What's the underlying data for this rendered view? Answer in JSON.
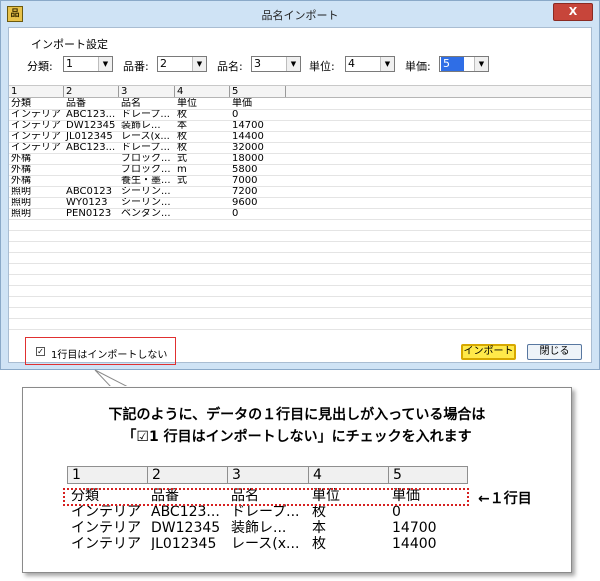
{
  "window": {
    "title": "品名インポート",
    "close_label": "X",
    "app_icon_label": "品"
  },
  "settings": {
    "group_label": "インポート設定",
    "fields": [
      {
        "label": "分類:",
        "value": "1"
      },
      {
        "label": "品番:",
        "value": "2"
      },
      {
        "label": "品名:",
        "value": "3"
      },
      {
        "label": "単位:",
        "value": "4"
      },
      {
        "label": "単価:",
        "value": "5"
      }
    ]
  },
  "grid": {
    "columns": [
      "1",
      "2",
      "3",
      "4",
      "5"
    ],
    "rows": [
      [
        "分類",
        "品番",
        "品名",
        "単位",
        "単価"
      ],
      [
        "インテリア",
        "ABC123...",
        "ドレープ...",
        "枚",
        "0"
      ],
      [
        "インテリア",
        "DW12345",
        "装飾レ...",
        "本",
        "14700"
      ],
      [
        "インテリア",
        "JL012345",
        "レース(x...",
        "枚",
        "14400"
      ],
      [
        "インテリア",
        "ABC123...",
        "ドレープ...",
        "枚",
        "32000"
      ],
      [
        "外構",
        "",
        "ブロック...",
        "式",
        "18000"
      ],
      [
        "外構",
        "",
        "ブロック...",
        "m",
        "5800"
      ],
      [
        "外構",
        "",
        "養生・墨...",
        "式",
        "7000"
      ],
      [
        "照明",
        "ABC0123",
        "シーリン...",
        "",
        "7200"
      ],
      [
        "照明",
        "WY0123",
        "シーリン...",
        "",
        "9600"
      ],
      [
        "照明",
        "PEN0123",
        "ペンダン...",
        "",
        "0"
      ]
    ]
  },
  "options": {
    "skip_first_row_label": "1行目はインポートしない",
    "checkmark": "✓"
  },
  "buttons": {
    "import_label": "インポート",
    "close_label": "閉じる"
  },
  "callout": {
    "line1": "下記のように、データの１行目に見出しが入っている場合は",
    "line2": "「☑1 行目はインポートしない」にチェックを入れます",
    "zoom_columns": [
      "1",
      "2",
      "3",
      "4",
      "5"
    ],
    "zoom_rows": [
      [
        "分類",
        "品番",
        "品名",
        "単位",
        "単価"
      ],
      [
        "インテリア",
        "ABC123...",
        "ドレープ...",
        "枚",
        "0"
      ],
      [
        "インテリア",
        "DW12345",
        "装飾レ...",
        "本",
        "14700"
      ],
      [
        "インテリア",
        "JL012345",
        "レース(x...",
        "枚",
        "14400"
      ]
    ],
    "arrow_label": "←１行目"
  },
  "colors": {
    "highlight_red": "#d62020",
    "import_button": "#ffe94a",
    "selected_blue": "#2f6ee6"
  }
}
